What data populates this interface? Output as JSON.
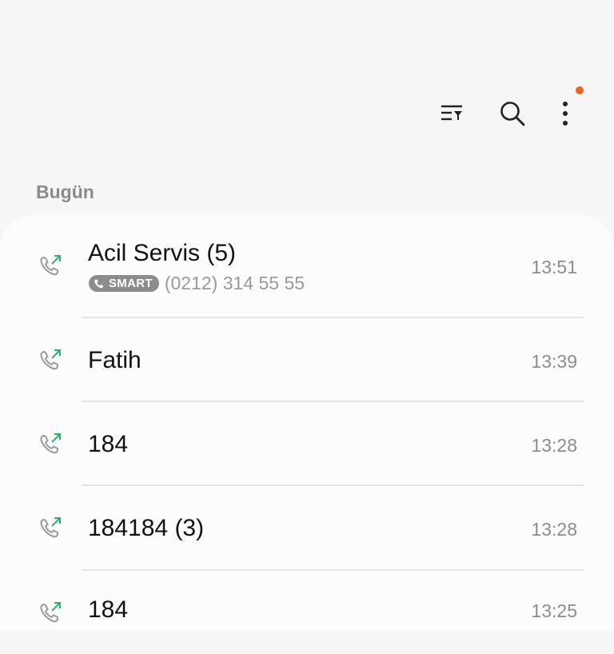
{
  "toolbar": {
    "icons": [
      "filter-icon",
      "search-icon",
      "more-options-icon"
    ],
    "notification_color": "#f0641e"
  },
  "section": {
    "label": "Bugün"
  },
  "calls": [
    {
      "name": "Acil Servis (5)",
      "badge": "SMART",
      "number": "(0212) 314 55 55",
      "time": "13:51",
      "type": "outgoing"
    },
    {
      "name": "Fatih",
      "time": "13:39",
      "type": "outgoing"
    },
    {
      "name": "184",
      "time": "13:28",
      "type": "outgoing"
    },
    {
      "name": "184184 (3)",
      "time": "13:28",
      "type": "outgoing"
    },
    {
      "name": "184",
      "time": "13:25",
      "type": "outgoing"
    }
  ],
  "colors": {
    "outgoing_arrow": "#2fae6c",
    "phone_icon": "#9a9a9a"
  }
}
